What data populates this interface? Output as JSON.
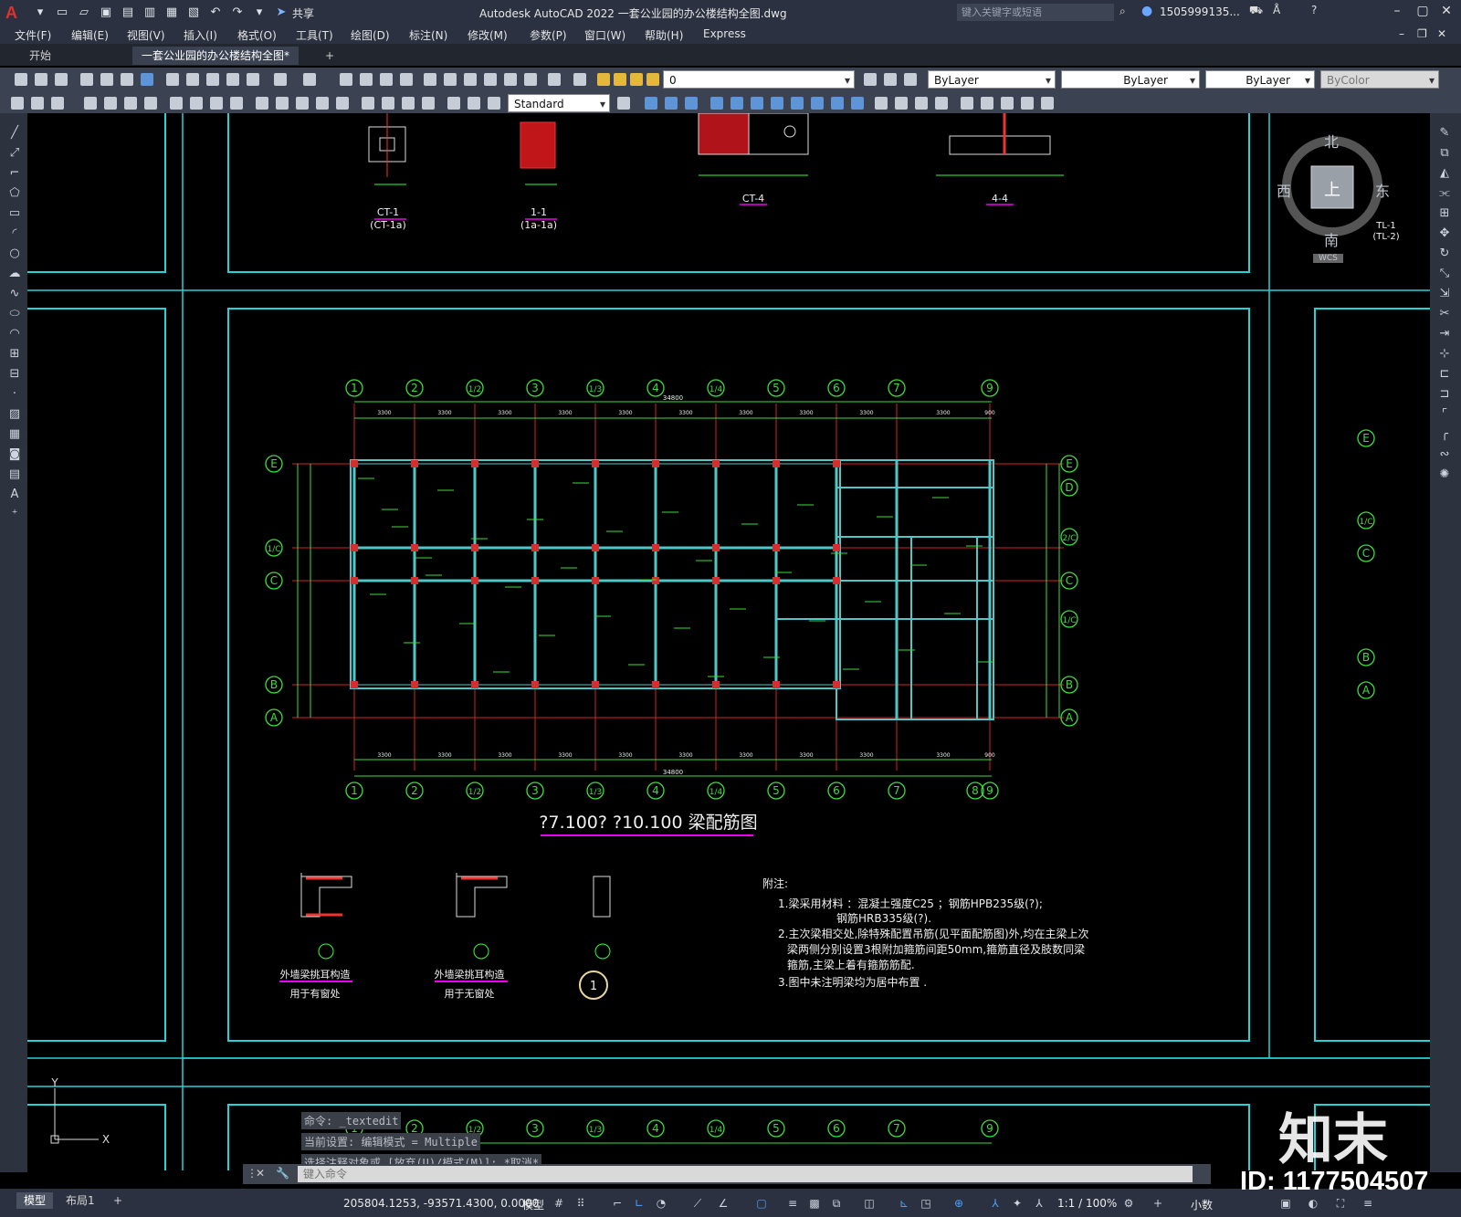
{
  "app": {
    "title": "Autodesk AutoCAD 2022    一套公业园的办公楼结构全图.dwg",
    "share_label": "共享",
    "search_placeholder": "键入关键字或短语",
    "user": "1505999135..."
  },
  "menu": [
    "文件(F)",
    "编辑(E)",
    "视图(V)",
    "插入(I)",
    "格式(O)",
    "工具(T)",
    "绘图(D)",
    "标注(N)",
    "修改(M)",
    "参数(P)",
    "窗口(W)",
    "帮助(H)",
    "Express"
  ],
  "tabs": {
    "start": "开始",
    "active": "一套公业园的办公楼结构全图*",
    "new": "+"
  },
  "properties": {
    "layer": "0",
    "color": "ByLayer",
    "linetype": "ByLayer",
    "lineweight": "ByLayer",
    "plotstyle": "ByColor",
    "text_style": "Standard"
  },
  "viewcube": {
    "north": "北",
    "south": "南",
    "west": "西",
    "east": "东",
    "top": "上",
    "wcs": "WCS"
  },
  "drawing": {
    "plan_title": "?7.100? ?10.100  梁配筋图",
    "grid_top": [
      "1",
      "2",
      "1/2",
      "3",
      "1/3",
      "4",
      "1/4",
      "5",
      "6",
      "7",
      "9"
    ],
    "grid_bottom": [
      "1",
      "2",
      "1/2",
      "3",
      "1/3",
      "4",
      "1/4",
      "5",
      "6",
      "7",
      "8",
      "9"
    ],
    "grid_left": [
      "E",
      "1/C",
      "C",
      "B",
      "A"
    ],
    "grid_right": [
      "E",
      "D",
      "2/C",
      "C",
      "1/C",
      "B",
      "A"
    ],
    "grid_far_right": [
      "E",
      "1/C",
      "C",
      "B",
      "A"
    ],
    "dim_total": "34800",
    "dims": [
      "3300",
      "3300",
      "3300",
      "3300",
      "3300",
      "3300",
      "3300",
      "3300",
      "3300",
      "3300",
      "900"
    ],
    "sections": [
      {
        "label": "CT-1",
        "sub": "(CT-1a)"
      },
      {
        "label": "1-1",
        "sub": "(1a-1a)"
      },
      {
        "label": "CT-4",
        "sub": ""
      },
      {
        "label": "4-4",
        "sub": ""
      }
    ],
    "details": [
      {
        "title": "外墙梁挑耳构造",
        "sub": "用于有窗处"
      },
      {
        "title": "外墙梁挑耳构造",
        "sub": "用于无窗处"
      }
    ],
    "detail_mark": "1",
    "notes_title": "附注:",
    "notes": [
      "1.梁采用材料 ：混凝土强度C25 ；钢筋HPB235级(?);",
      "钢筋HRB335级(?).",
      "2.主次梁相交处,除特殊配置吊筋(见平面配筋图)外,均在主梁上次",
      "梁两侧分别设置3根附加箍筋间距50mm,箍筋直径及肢数同梁",
      "箍筋,主梁上着有箍筋筋配.",
      "3.图中未注明梁均为居中布置 ."
    ],
    "tl_label": "TL-1",
    "tl_sub": "(TL-2)"
  },
  "command": {
    "history": [
      "命令: _textedit",
      "当前设置: 编辑模式 = Multiple",
      "选择注释对象或 [放弃(U)/模式(M)]: *取消*"
    ],
    "placeholder": "键入命令"
  },
  "status": {
    "model_tab": "模型",
    "layout_tab": "布局1",
    "add": "+",
    "coords": "205804.1253, -93571.4300, 0.0000",
    "space": "模型",
    "scale": "1:1 / 100%",
    "units": "小数"
  },
  "watermark": {
    "logo": "知末",
    "id": "ID: 1177504507"
  }
}
